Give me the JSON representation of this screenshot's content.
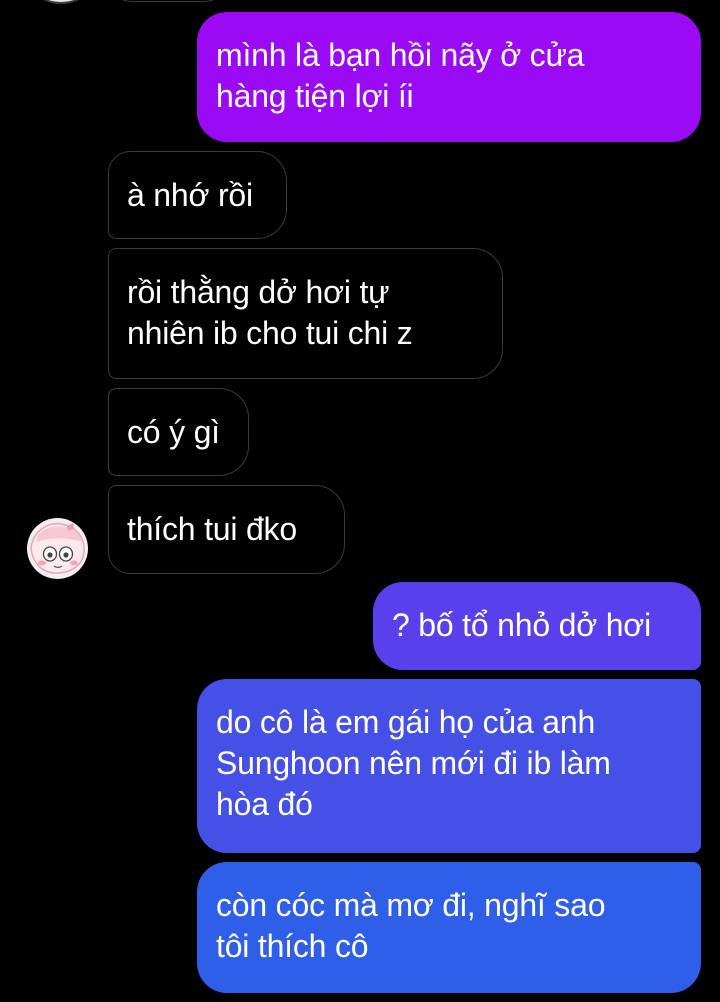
{
  "messages": [
    {
      "sender": "me",
      "text": "mình là bạn hồi nãy ở cửa hàng tiện lợi íi",
      "lines": [
        "mình là bạn hồi nãy ở cửa",
        "hàng tiện lợi íi"
      ],
      "color": "#9B0AF5"
    },
    {
      "sender": "them",
      "text": "à nhớ rồi",
      "lines": [
        "à nhớ rồi"
      ]
    },
    {
      "sender": "them",
      "text": "rồi thằng dở hơi tự nhiên ib cho tui chi z",
      "lines": [
        "rồi thằng dở hơi tự",
        "nhiên ib cho tui chi z"
      ]
    },
    {
      "sender": "them",
      "text": "có ý gì",
      "lines": [
        "có ý gì"
      ]
    },
    {
      "sender": "them",
      "text": "thích tui đko",
      "lines": [
        "thích tui đko"
      ]
    },
    {
      "sender": "me",
      "text": "? bố tổ nhỏ dở hơi",
      "lines": [
        "? bố tổ nhỏ dở hơi"
      ],
      "color": "#5A3FEC"
    },
    {
      "sender": "me",
      "text": "do cô là em gái họ của anh Sunghoon nên mới đi ib làm hòa đó",
      "lines": [
        "do cô là em gái họ của anh",
        "Sunghoon nên mới đi ib làm",
        "hòa đó"
      ],
      "color": "#4450E6"
    },
    {
      "sender": "me",
      "text": "còn cóc mà mơ đi, nghĩ sao tôi thích cô",
      "lines": [
        "còn cóc mà mơ đi, nghĩ sao",
        "tôi thích cô"
      ],
      "color": "#2F5FE8"
    }
  ],
  "contact": {
    "avatar": "cartoon-character-avatar"
  },
  "colors": {
    "background": "#000000",
    "incoming_border": "#3a3a3a",
    "text": "#ffffff"
  }
}
